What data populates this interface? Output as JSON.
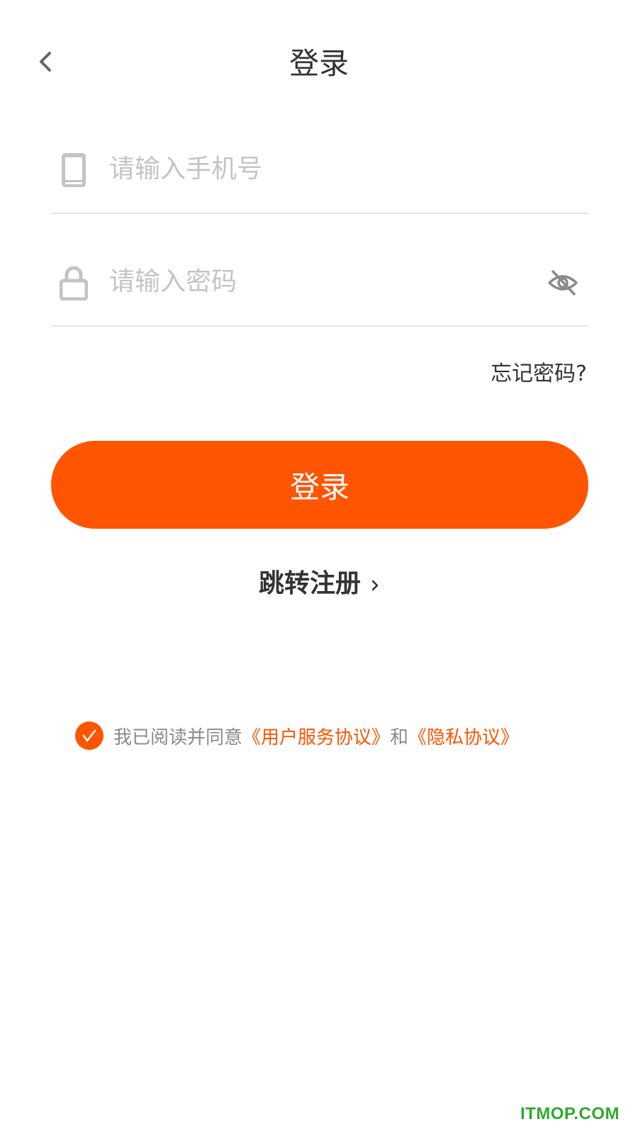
{
  "header": {
    "title": "登录",
    "back_icon": "chevron-left-icon"
  },
  "phone_field": {
    "placeholder": "请输入手机号",
    "value": "",
    "icon": "phone-icon"
  },
  "password_field": {
    "placeholder": "请输入密码",
    "value": "",
    "icon": "lock-icon",
    "toggle_icon": "eye-off-icon"
  },
  "forgot_password": "忘记密码?",
  "login_button": "登录",
  "register_link": {
    "label": "跳转注册",
    "icon": "chevron-right-icon"
  },
  "agreement": {
    "checked": true,
    "prefix": "我已阅读并同意",
    "user_agreement": "《用户服务协议》",
    "conjunction": "和",
    "privacy_policy": "《隐私协议》"
  },
  "watermark": "ITMOP.COM",
  "colors": {
    "accent": "#ff5400",
    "text": "#333333",
    "placeholder": "#c4c4c4",
    "divider": "#e6e6e6",
    "watermark": "#2eaa2e"
  }
}
